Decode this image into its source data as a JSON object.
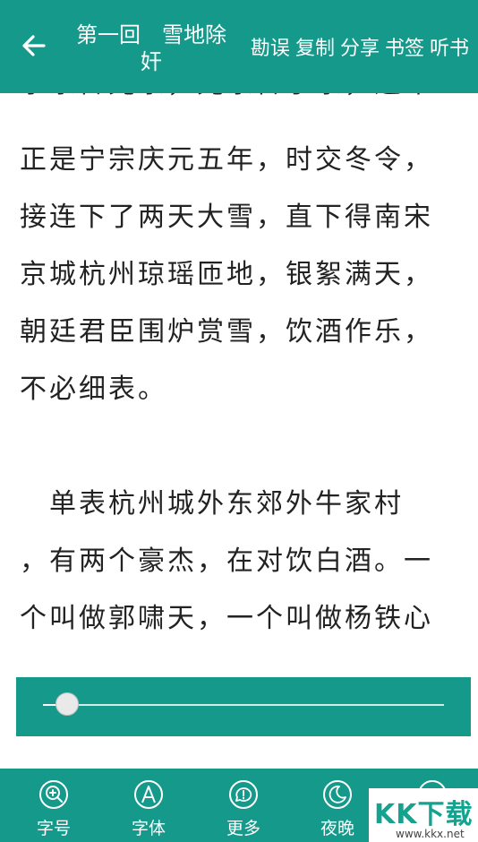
{
  "header": {
    "title": "第一回　雪地除奸",
    "actions": [
      "勘误",
      "复制",
      "分享",
      "书签",
      "听书"
    ]
  },
  "content": {
    "lines": [
      "李宗传光宗，光宗传宁宗，这年",
      "正是宁宗庆元五年，时交冬令，",
      "接连下了两天大雪，直下得南宋",
      "京城杭州琼瑶匝地，银絮满天，",
      "朝廷君臣围炉赏雪，饮酒作乐，",
      "不必细表。",
      "",
      "　单表杭州城外东郊外牛家村",
      "，有两个豪杰，在对饮白酒。一",
      "个叫做郭啸天，一个叫做杨铁心"
    ]
  },
  "slider": {
    "progress": 0.06
  },
  "toolbar": {
    "items": [
      {
        "label": "字号",
        "icon": "zoom-icon"
      },
      {
        "label": "字体",
        "icon": "font-icon"
      },
      {
        "label": "更多",
        "icon": "more-icon"
      },
      {
        "label": "夜晚",
        "icon": "moon-icon"
      }
    ]
  },
  "watermark": {
    "text": "KK下载",
    "url": "www.kkx.net"
  },
  "colors": {
    "primary": "#14998a",
    "text": "#222222"
  }
}
